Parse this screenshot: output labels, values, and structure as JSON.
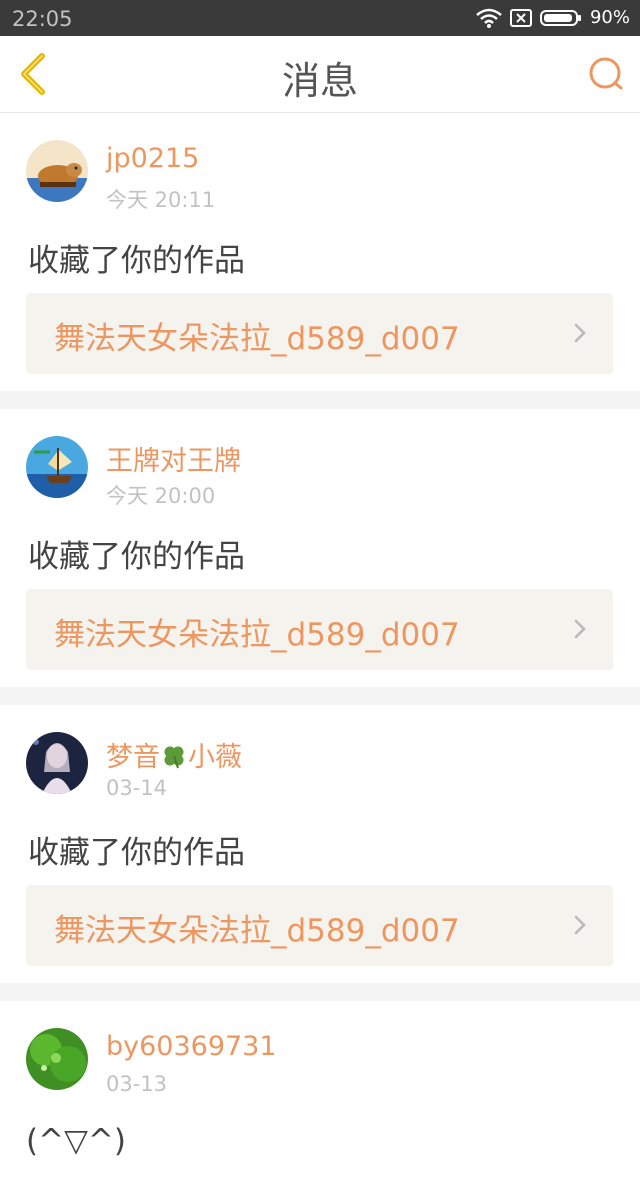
{
  "status_bar": {
    "time": "22:05",
    "battery": "90%"
  },
  "header": {
    "title": "消息"
  },
  "messages": [
    {
      "username": "jp0215",
      "time": "今天 20:11",
      "action": "收藏了你的作品",
      "work": "舞法天女朵法拉_d589_d007"
    },
    {
      "username": "王牌对王牌",
      "time": "今天 20:00",
      "action": "收藏了你的作品",
      "work": "舞法天女朵法拉_d589_d007"
    },
    {
      "username_prefix": "梦音",
      "username_suffix": "小薇",
      "time": "03-14",
      "action": "收藏了你的作品",
      "work": "舞法天女朵法拉_d589_d007"
    },
    {
      "username": "by60369731",
      "time": "03-13",
      "action": "(^▽^)"
    }
  ],
  "colors": {
    "accent": "#ee9660",
    "back_icon": "#e6b800",
    "card_bg": "#f4f3ee"
  }
}
